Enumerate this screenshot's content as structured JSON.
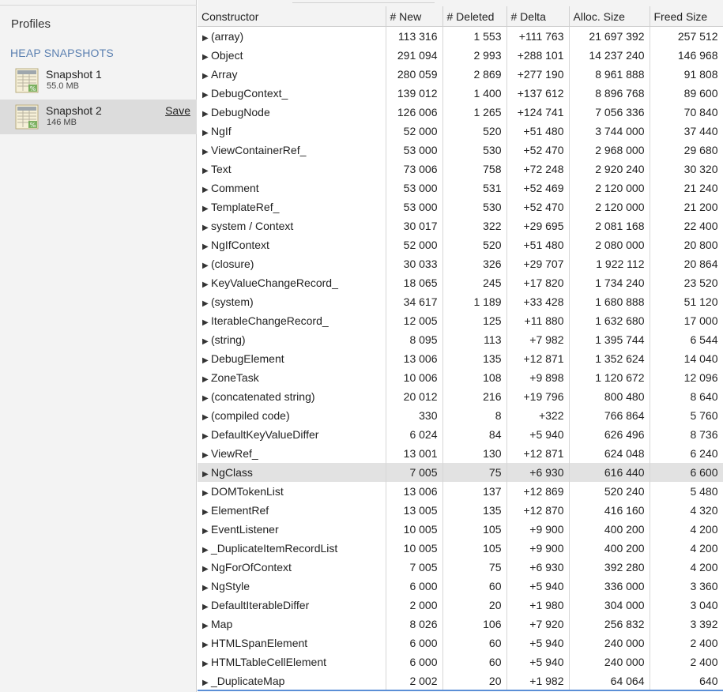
{
  "sidebar": {
    "profiles_title": "Profiles",
    "section_title": "HEAP SNAPSHOTS",
    "snapshots": [
      {
        "name": "Snapshot 1",
        "size": "55.0 MB"
      },
      {
        "name": "Snapshot 2",
        "size": "146 MB",
        "save_label": "Save"
      }
    ]
  },
  "table": {
    "columns": [
      "Constructor",
      "# New",
      "# Deleted",
      "# Delta",
      "Alloc. Size",
      "Freed Size"
    ],
    "rows": [
      [
        "(array)",
        "113 316",
        "1 553",
        "+111 763",
        "21 697 392",
        "257 512"
      ],
      [
        "Object",
        "291 094",
        "2 993",
        "+288 101",
        "14 237 240",
        "146 968"
      ],
      [
        "Array",
        "280 059",
        "2 869",
        "+277 190",
        "8 961 888",
        "91 808"
      ],
      [
        "DebugContext_",
        "139 012",
        "1 400",
        "+137 612",
        "8 896 768",
        "89 600"
      ],
      [
        "DebugNode",
        "126 006",
        "1 265",
        "+124 741",
        "7 056 336",
        "70 840"
      ],
      [
        "NgIf",
        "52 000",
        "520",
        "+51 480",
        "3 744 000",
        "37 440"
      ],
      [
        "ViewContainerRef_",
        "53 000",
        "530",
        "+52 470",
        "2 968 000",
        "29 680"
      ],
      [
        "Text",
        "73 006",
        "758",
        "+72 248",
        "2 920 240",
        "30 320"
      ],
      [
        "Comment",
        "53 000",
        "531",
        "+52 469",
        "2 120 000",
        "21 240"
      ],
      [
        "TemplateRef_",
        "53 000",
        "530",
        "+52 470",
        "2 120 000",
        "21 200"
      ],
      [
        "system / Context",
        "30 017",
        "322",
        "+29 695",
        "2 081 168",
        "22 400"
      ],
      [
        "NgIfContext",
        "52 000",
        "520",
        "+51 480",
        "2 080 000",
        "20 800"
      ],
      [
        "(closure)",
        "30 033",
        "326",
        "+29 707",
        "1 922 112",
        "20 864"
      ],
      [
        "KeyValueChangeRecord_",
        "18 065",
        "245",
        "+17 820",
        "1 734 240",
        "23 520"
      ],
      [
        "(system)",
        "34 617",
        "1 189",
        "+33 428",
        "1 680 888",
        "51 120"
      ],
      [
        "IterableChangeRecord_",
        "12 005",
        "125",
        "+11 880",
        "1 632 680",
        "17 000"
      ],
      [
        "(string)",
        "8 095",
        "113",
        "+7 982",
        "1 395 744",
        "6 544"
      ],
      [
        "DebugElement",
        "13 006",
        "135",
        "+12 871",
        "1 352 624",
        "14 040"
      ],
      [
        "ZoneTask",
        "10 006",
        "108",
        "+9 898",
        "1 120 672",
        "12 096"
      ],
      [
        "(concatenated string)",
        "20 012",
        "216",
        "+19 796",
        "800 480",
        "8 640"
      ],
      [
        "(compiled code)",
        "330",
        "8",
        "+322",
        "766 864",
        "5 760"
      ],
      [
        "DefaultKeyValueDiffer",
        "6 024",
        "84",
        "+5 940",
        "626 496",
        "8 736"
      ],
      [
        "ViewRef_",
        "13 001",
        "130",
        "+12 871",
        "624 048",
        "6 240"
      ],
      [
        "NgClass",
        "7 005",
        "75",
        "+6 930",
        "616 440",
        "6 600"
      ],
      [
        "DOMTokenList",
        "13 006",
        "137",
        "+12 869",
        "520 240",
        "5 480"
      ],
      [
        "ElementRef",
        "13 005",
        "135",
        "+12 870",
        "416 160",
        "4 320"
      ],
      [
        "EventListener",
        "10 005",
        "105",
        "+9 900",
        "400 200",
        "4 200"
      ],
      [
        "_DuplicateItemRecordList",
        "10 005",
        "105",
        "+9 900",
        "400 200",
        "4 200"
      ],
      [
        "NgForOfContext",
        "7 005",
        "75",
        "+6 930",
        "392 280",
        "4 200"
      ],
      [
        "NgStyle",
        "6 000",
        "60",
        "+5 940",
        "336 000",
        "3 360"
      ],
      [
        "DefaultIterableDiffer",
        "2 000",
        "20",
        "+1 980",
        "304 000",
        "3 040"
      ],
      [
        "Map",
        "8 026",
        "106",
        "+7 920",
        "256 832",
        "3 392"
      ],
      [
        "HTMLSpanElement",
        "6 000",
        "60",
        "+5 940",
        "240 000",
        "2 400"
      ],
      [
        "HTMLTableCellElement",
        "6 000",
        "60",
        "+5 940",
        "240 000",
        "2 400"
      ],
      [
        "_DuplicateMap",
        "2 002",
        "20",
        "+1 982",
        "64 064",
        "640"
      ]
    ],
    "highlighted_row": "NgClass"
  },
  "colors": {
    "section_title": "#5a7fb0",
    "selected_snapshot_bg": "#dcdcdc",
    "highlight_row_bg": "#e2e2e2",
    "bottom_accent": "#5b8fd6"
  },
  "icons": {
    "snapshot": "heap-snapshot-icon",
    "row_expander": "triangle-right-icon"
  }
}
